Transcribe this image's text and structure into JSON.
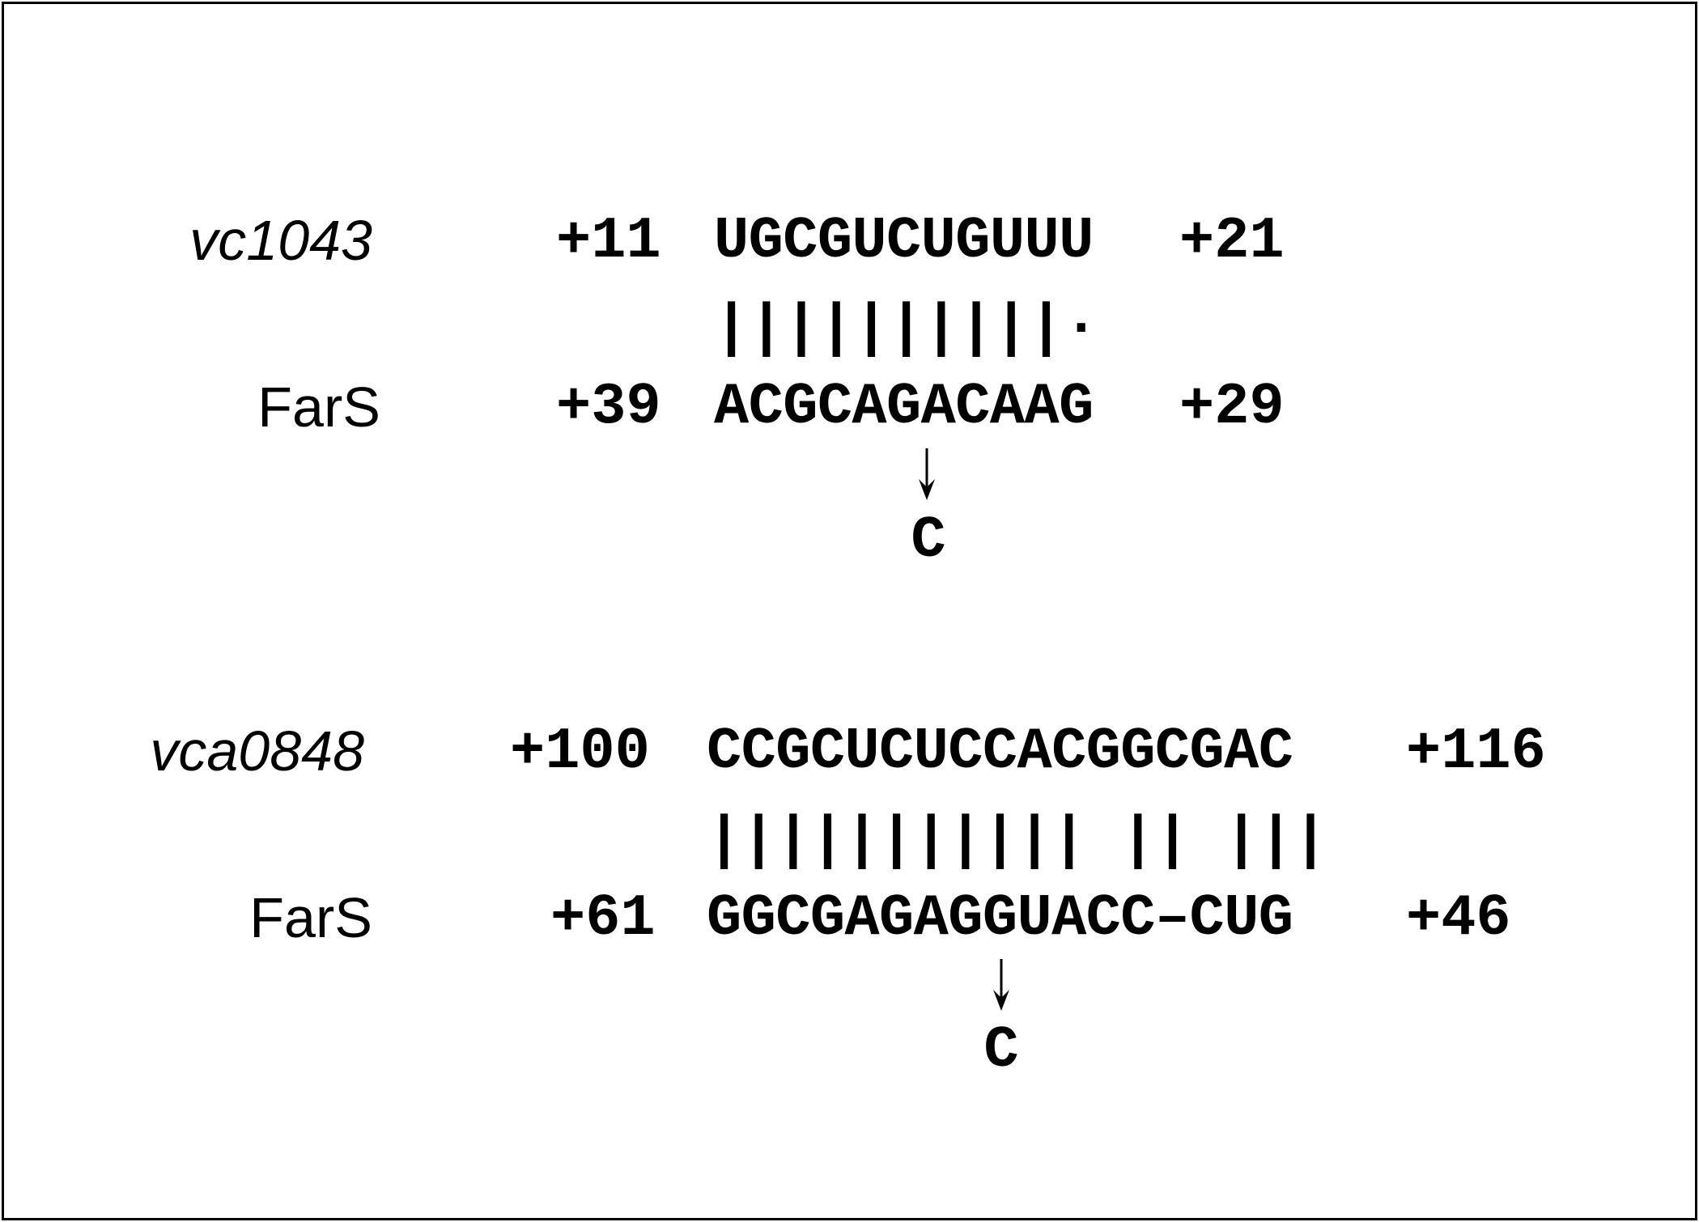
{
  "panel1": {
    "gene": "vc1043",
    "rna": "FarS",
    "top_start": "+11",
    "top_seq": "UGCGUCUGUUU",
    "top_end": "+21",
    "pairing": "||||||||||·",
    "bottom_start": "+39",
    "bottom_seq": "ACGCAGACAAG",
    "bottom_end": "+29",
    "mutation": "C"
  },
  "panel2": {
    "gene": "vca0848",
    "rna": "FarS",
    "top_start": "+100",
    "top_seq": "CCGCUCUCCACGGCGAC",
    "top_end": "+116",
    "pairing": "||||||||||| || |||",
    "bottom_start": "+61",
    "bottom_seq": "GGCGAGAGGUACC–CUG",
    "bottom_end": "+46",
    "mutation": "C"
  }
}
